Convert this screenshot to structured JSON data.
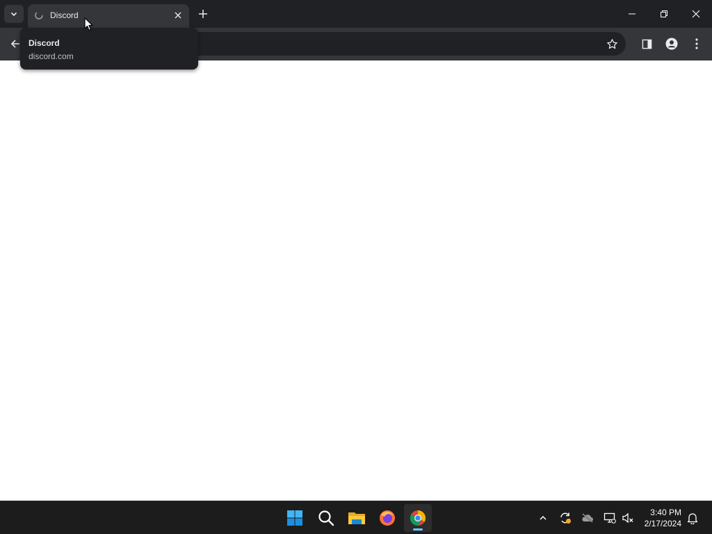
{
  "browser": {
    "tabs": [
      {
        "title": "Discord",
        "favicon": "loading-favicon-icon",
        "active": true
      }
    ],
    "tab_tooltip": {
      "title": "Discord",
      "url": "discord.com"
    },
    "toolbar": {
      "icons": [
        "back-arrow-icon",
        "bookmark-star-icon",
        "side-panel-icon",
        "profile-icon",
        "more-menu-icon"
      ]
    },
    "window_controls": [
      "minimize-icon",
      "restore-icon",
      "close-icon"
    ]
  },
  "taskbar": {
    "apps": [
      "windows-start-icon",
      "search-icon",
      "file-explorer-icon",
      "firefox-icon",
      "chrome-icon"
    ],
    "active_app": "chrome-icon",
    "tray_icons": [
      "chevron-up-icon",
      "sync-icon",
      "onedrive-cloud-icon",
      "network-icon",
      "volume-muted-icon",
      "notification-bell-icon"
    ],
    "clock": {
      "time": "3:40 PM",
      "date": "2/17/2024"
    }
  },
  "colors": {
    "tabstrip_bg": "#202124",
    "toolbar_bg": "#35363a",
    "taskbar_bg": "#1c1c1c",
    "accent": "#60cdff"
  }
}
